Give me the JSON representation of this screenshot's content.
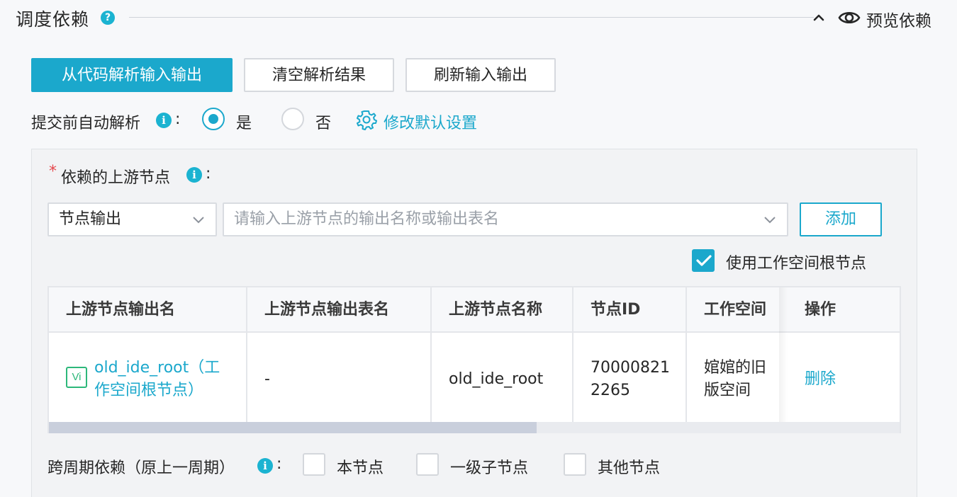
{
  "section": {
    "title": "调度依赖",
    "help_icon": "question-circle-icon",
    "preview_label": "预览依赖"
  },
  "actions": {
    "parse_from_code": "从代码解析输入输出",
    "clear_parse": "清空解析结果",
    "refresh_io": "刷新输入输出"
  },
  "auto_parse": {
    "label": "提交前自动解析",
    "colon": ":",
    "yes": "是",
    "no": "否",
    "selected": "是",
    "modify_default": "修改默认设置"
  },
  "upstream": {
    "required_mark": "*",
    "label": "依赖的上游节点",
    "colon": ":",
    "type_select": "节点输出",
    "search_placeholder": "请输入上游节点的输出名称或输出表名",
    "add_button": "添加",
    "use_root_node_label": "使用工作空间根节点",
    "use_root_node_checked": true
  },
  "table": {
    "headers": [
      "上游节点输出名",
      "上游节点输出表名",
      "上游节点名称",
      "节点ID",
      "工作空间",
      "操作"
    ],
    "rows": [
      {
        "badge": "Vi",
        "output_name_line1": "old_ide_root（工",
        "output_name_line2": "作空间根节点）",
        "output_table": "-",
        "node_name": "old_ide_root",
        "node_id_line1": "70000821",
        "node_id_line2": "2265",
        "workspace_line1": "婠婠的旧",
        "workspace_line2": "版空间",
        "action": "删除"
      }
    ],
    "horizontal_scroll_fraction": 0.57
  },
  "cross_cycle": {
    "label": "跨周期依赖（原上一周期）",
    "colon": ":",
    "options": [
      "本节点",
      "一级子节点",
      "其他节点"
    ]
  },
  "colors": {
    "accent": "#1ba8cc",
    "required": "#e5484d",
    "badge": "#2db87a"
  }
}
